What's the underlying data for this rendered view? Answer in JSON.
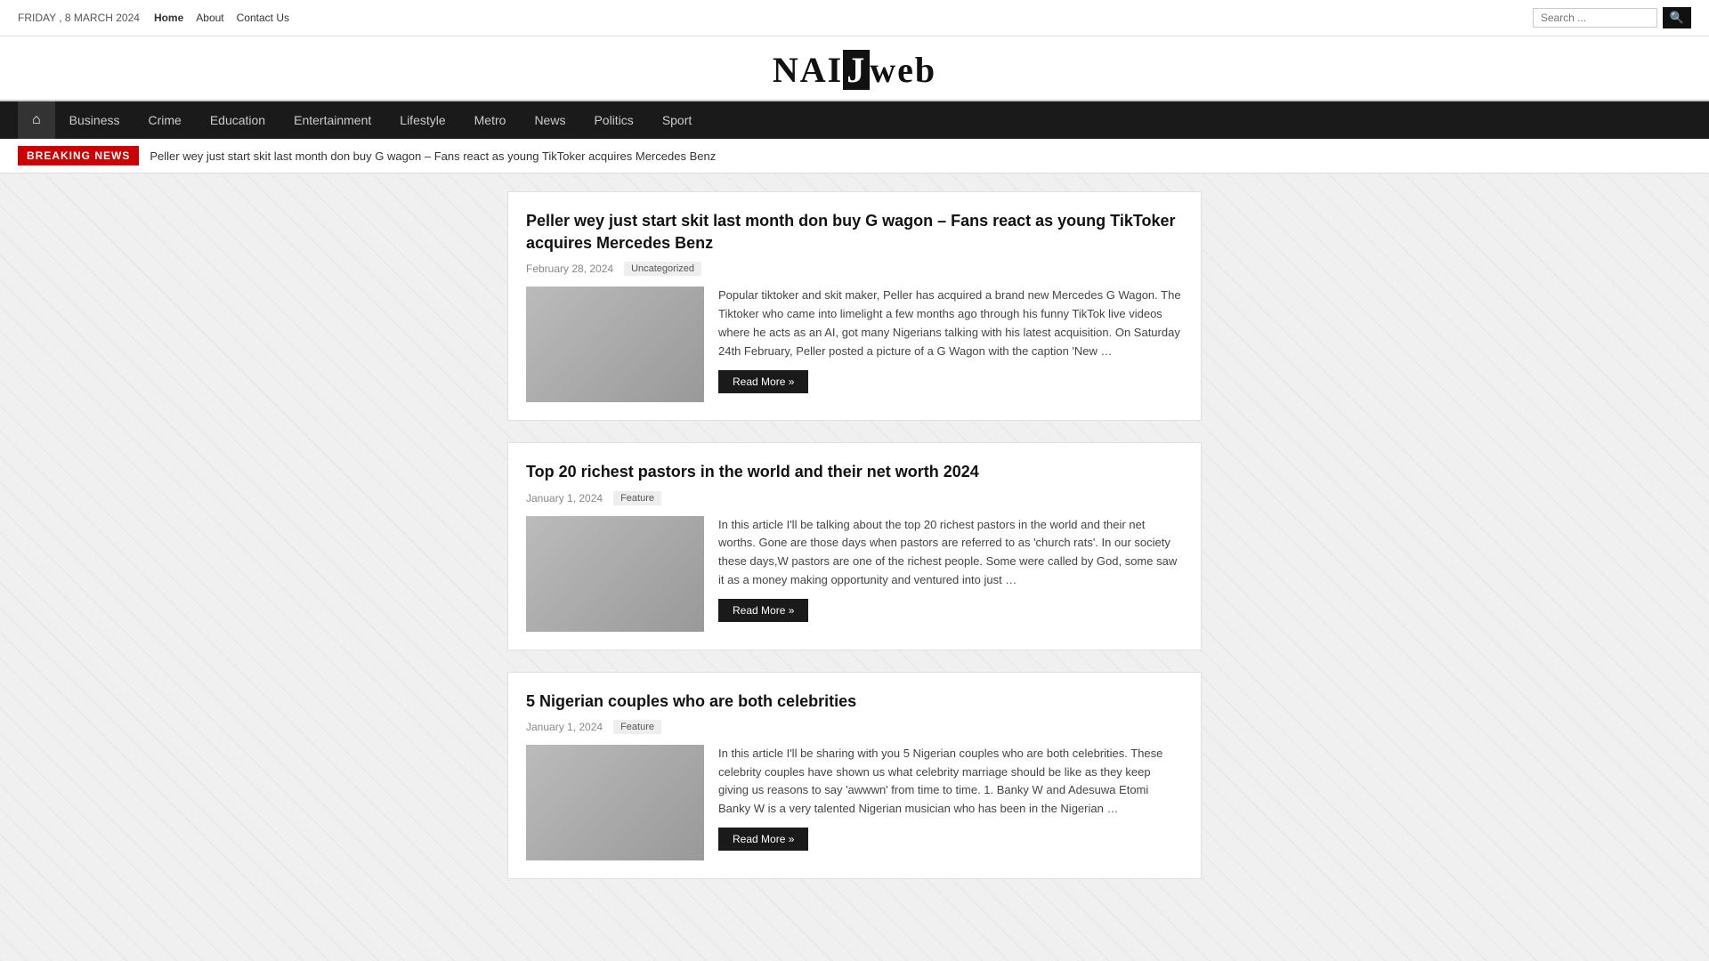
{
  "topbar": {
    "date": "FRIDAY , 8 MARCH 2024",
    "nav": [
      {
        "label": "Home",
        "active": true
      },
      {
        "label": "About"
      },
      {
        "label": "Contact Us"
      }
    ],
    "search_placeholder": "Search ..."
  },
  "logo": {
    "part1": "NAI",
    "part2": "J",
    "part3": "web"
  },
  "nav": {
    "home_icon": "⌂",
    "items": [
      {
        "label": "Business"
      },
      {
        "label": "Crime"
      },
      {
        "label": "Education"
      },
      {
        "label": "Entertainment"
      },
      {
        "label": "Lifestyle"
      },
      {
        "label": "Metro"
      },
      {
        "label": "News"
      },
      {
        "label": "Politics"
      },
      {
        "label": "Sport"
      }
    ]
  },
  "breaking": {
    "label": "BREAKING NEWS",
    "text": "Peller wey just start skit last month don buy G wagon – Fans react as young TikToker acquires Mercedes Benz"
  },
  "articles": [
    {
      "title": "Peller wey just start skit last month don buy G wagon – Fans react as young TikToker acquires Mercedes Benz",
      "date": "February 28, 2024",
      "tag": "Uncategorized",
      "body": "Popular tiktoker and skit maker, Peller has acquired a brand new Mercedes G Wagon. The Tiktoker who came into limelight a few months ago through his funny TikTok live videos where he acts as an AI, got many Nigerians talking with his latest acquisition. On Saturday 24th February, Peller posted a picture of a G Wagon with the caption 'New …",
      "read_more": "Read More »"
    },
    {
      "title": "Top 20 richest pastors in the world and their net worth 2024",
      "date": "January 1, 2024",
      "tag": "Feature",
      "body": "In this article I'll be talking about the top 20 richest pastors in the world and their net worths. Gone are those days when pastors are referred to as 'church rats'. In our society these days,W pastors are one of the richest people. Some were called by God, some saw it as a money making opportunity and ventured into just …",
      "read_more": "Read More »"
    },
    {
      "title": "5 Nigerian couples who are both celebrities",
      "date": "January 1, 2024",
      "tag": "Feature",
      "body": "In this article I'll be sharing with you 5 Nigerian couples who are both celebrities. These celebrity couples have shown us what celebrity marriage should be like as they keep giving us reasons to say 'awwwn' from time to time. 1. Banky W and Adesuwa Etomi Banky W is a very talented Nigerian musician who has been in the Nigerian …",
      "read_more": "Read More »"
    }
  ]
}
